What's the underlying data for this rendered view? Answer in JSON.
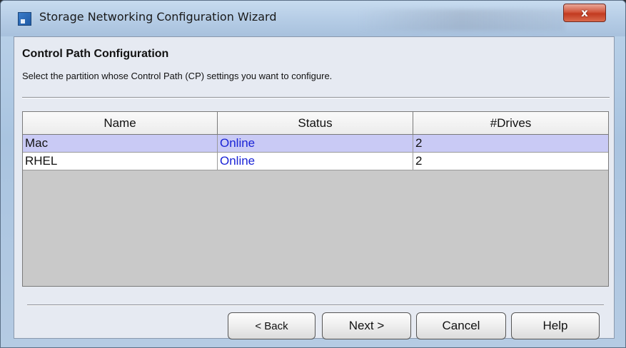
{
  "window": {
    "title": "Storage Networking Configuration Wizard",
    "close_label": "x"
  },
  "page": {
    "heading": "Control Path Configuration",
    "instruction": "Select the partition whose Control Path (CP) settings you want to configure."
  },
  "table": {
    "columns": [
      "Name",
      "Status",
      "#Drives"
    ],
    "rows": [
      {
        "name": "Mac",
        "status": "Online",
        "drives": "2",
        "selected": true
      },
      {
        "name": "RHEL",
        "status": "Online",
        "drives": "2",
        "selected": false
      }
    ]
  },
  "buttons": {
    "back": "< Back",
    "next": "Next >",
    "cancel": "Cancel",
    "help": "Help"
  },
  "colors": {
    "selected_row": "#c9caf5",
    "status_text": "#1a23d6",
    "table_empty_area": "#c9c9c9"
  }
}
